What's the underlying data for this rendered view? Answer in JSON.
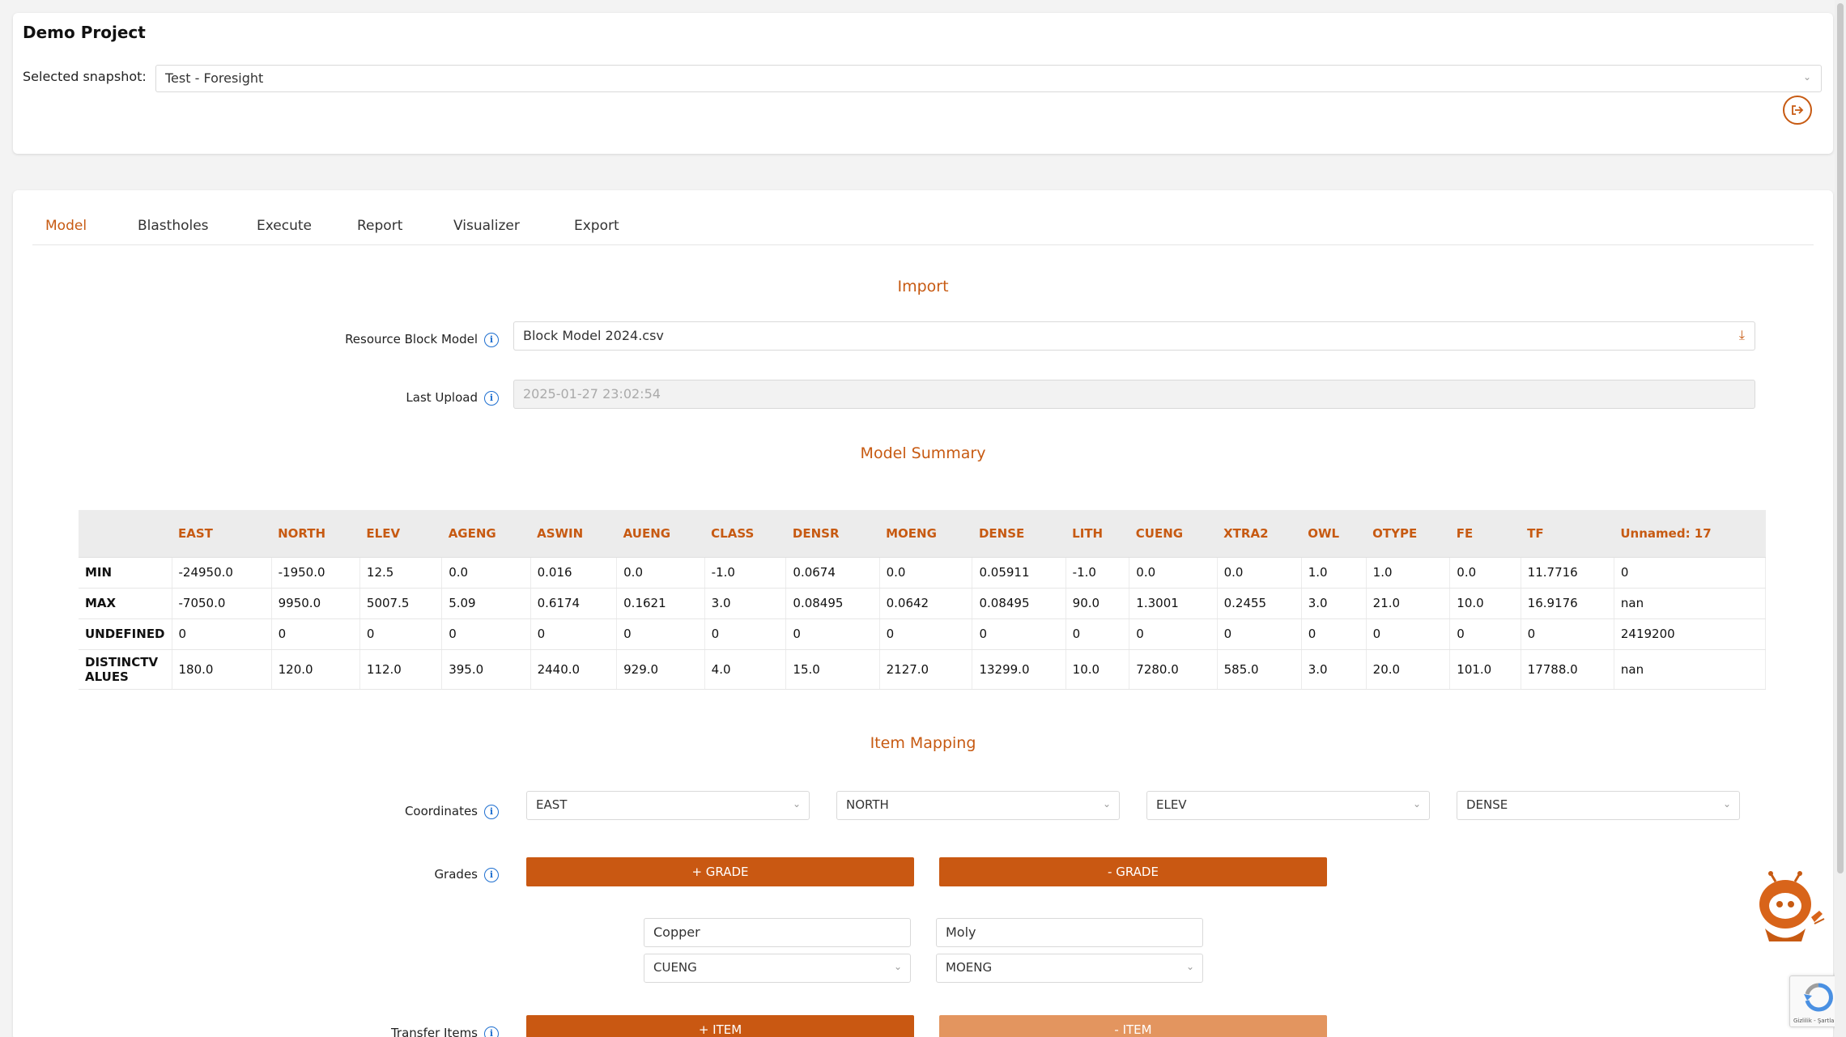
{
  "header": {
    "project_title": "Demo Project",
    "snapshot_label": "Selected snapshot:",
    "snapshot_value": "Test - Foresight"
  },
  "tabs": [
    "Model",
    "Blastholes",
    "Execute",
    "Report",
    "Visualizer",
    "Export"
  ],
  "active_tab": "Model",
  "import": {
    "title": "Import",
    "resource_label": "Resource Block Model",
    "resource_value": "Block Model 2024.csv",
    "last_upload_label": "Last Upload",
    "last_upload_value": "2025-01-27 23:02:54"
  },
  "summary": {
    "title": "Model Summary",
    "columns": [
      "EAST",
      "NORTH",
      "ELEV",
      "AGENG",
      "ASWIN",
      "AUENG",
      "CLASS",
      "DENSR",
      "MOENG",
      "DENSE",
      "LITH",
      "CUENG",
      "XTRA2",
      "OWL",
      "OTYPE",
      "FE",
      "TF",
      "Unnamed: 17"
    ],
    "rows": [
      {
        "label": "MIN",
        "values": [
          "-24950.0",
          "-1950.0",
          "12.5",
          "0.0",
          "0.016",
          "0.0",
          "-1.0",
          "0.0674",
          "0.0",
          "0.05911",
          "-1.0",
          "0.0",
          "0.0",
          "1.0",
          "1.0",
          "0.0",
          "11.7716",
          "0"
        ]
      },
      {
        "label": "MAX",
        "values": [
          "-7050.0",
          "9950.0",
          "5007.5",
          "5.09",
          "0.6174",
          "0.1621",
          "3.0",
          "0.08495",
          "0.0642",
          "0.08495",
          "90.0",
          "1.3001",
          "0.2455",
          "3.0",
          "21.0",
          "10.0",
          "16.9176",
          "nan"
        ]
      },
      {
        "label": "UNDEFINED",
        "values": [
          "0",
          "0",
          "0",
          "0",
          "0",
          "0",
          "0",
          "0",
          "0",
          "0",
          "0",
          "0",
          "0",
          "0",
          "0",
          "0",
          "0",
          "2419200"
        ]
      },
      {
        "label": "DISTINCTVALUES",
        "values": [
          "180.0",
          "120.0",
          "112.0",
          "395.0",
          "2440.0",
          "929.0",
          "4.0",
          "15.0",
          "2127.0",
          "13299.0",
          "10.0",
          "7280.0",
          "585.0",
          "3.0",
          "20.0",
          "101.0",
          "17788.0",
          "nan"
        ]
      }
    ]
  },
  "mapping": {
    "title": "Item Mapping",
    "coordinates_label": "Coordinates",
    "coordinates": [
      "EAST",
      "NORTH",
      "ELEV",
      "DENSE"
    ],
    "grades_label": "Grades",
    "add_grade": "+ GRADE",
    "remove_grade": "- GRADE",
    "grade_names": [
      "Copper",
      "Moly"
    ],
    "grade_fields": [
      "CUENG",
      "MOENG"
    ],
    "transfer_label": "Transfer Items",
    "add_item": "+ ITEM",
    "remove_item": "- ITEM"
  },
  "recaptcha_text": "Gizlilik - Şartlar",
  "colors": {
    "accent": "#c75a12",
    "button": "#c95812",
    "button_light": "#e3955f",
    "info": "#1e6fd0"
  }
}
